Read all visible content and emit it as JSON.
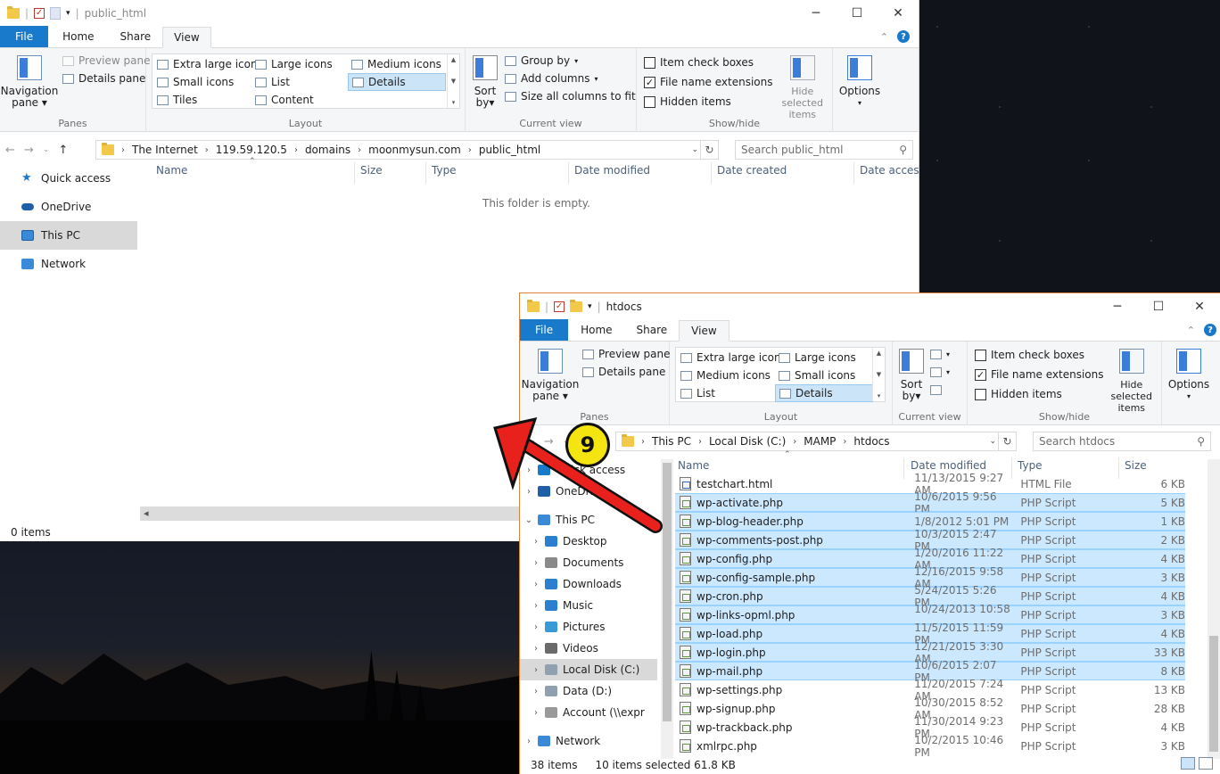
{
  "window1": {
    "title": "public_html",
    "tabs": {
      "file": "File",
      "home": "Home",
      "share": "Share",
      "view": "View"
    },
    "ribbon": {
      "panes": {
        "nav_pane": "Navigation",
        "nav_pane2": "pane",
        "preview": "Preview pane",
        "details": "Details pane",
        "label": "Panes"
      },
      "layout": {
        "items": [
          "Extra large icons",
          "Large icons",
          "Medium icons",
          "Small icons",
          "List",
          "Details",
          "Tiles",
          "Content"
        ],
        "selected": "Details",
        "label": "Layout"
      },
      "current_view": {
        "sort1": "Sort",
        "sort2": "by",
        "group": "Group by",
        "add_cols": "Add columns",
        "size_cols": "Size all columns to fit",
        "label": "Current view"
      },
      "show_hide": {
        "item_checkboxes": "Item check boxes",
        "file_ext": "File name extensions",
        "hidden": "Hidden items",
        "hide_sel1": "Hide selected",
        "hide_sel2": "items",
        "label": "Show/hide",
        "item_checkboxes_checked": false,
        "file_ext_checked": true,
        "hidden_checked": false
      },
      "options": "Options"
    },
    "address": {
      "crumbs": [
        "The Internet",
        "119.59.120.5",
        "domains",
        "moonmysun.com",
        "public_html"
      ]
    },
    "search": {
      "placeholder": "Search public_html"
    },
    "nav": [
      "Quick access",
      "OneDrive",
      "This PC",
      "Network"
    ],
    "nav_selected": "This PC",
    "columns": [
      "Name",
      "Size",
      "Type",
      "Date modified",
      "Date created",
      "Date accessed"
    ],
    "empty": "This folder is empty.",
    "status": "0 items"
  },
  "window2": {
    "title": "htdocs",
    "tabs": {
      "file": "File",
      "home": "Home",
      "share": "Share",
      "view": "View"
    },
    "ribbon": {
      "panes": {
        "nav_pane": "Navigation",
        "nav_pane2": "pane",
        "preview": "Preview pane",
        "details": "Details pane",
        "label": "Panes"
      },
      "layout": {
        "items": [
          "Extra large icons",
          "Large icons",
          "Medium icons",
          "Small icons",
          "List",
          "Details"
        ],
        "selected": "Details",
        "label": "Layout"
      },
      "current_view": {
        "sort1": "Sort",
        "sort2": "by",
        "label": "Current view"
      },
      "show_hide": {
        "item_checkboxes": "Item check boxes",
        "file_ext": "File name extensions",
        "hidden": "Hidden items",
        "hide_sel1": "Hide selected",
        "hide_sel2": "items",
        "label": "Show/hide"
      },
      "options": "Options"
    },
    "address": {
      "crumbs": [
        "This PC",
        "Local Disk (C:)",
        "MAMP",
        "htdocs"
      ]
    },
    "search": {
      "placeholder": "Search htdocs"
    },
    "nav": [
      {
        "label": "Quick access",
        "chev": "›"
      },
      {
        "label": "OneDrive",
        "chev": "›"
      },
      {
        "label": "This PC",
        "chev": "⌄"
      },
      {
        "label": "Desktop",
        "chev": "›"
      },
      {
        "label": "Documents",
        "chev": "›"
      },
      {
        "label": "Downloads",
        "chev": "›"
      },
      {
        "label": "Music",
        "chev": "›"
      },
      {
        "label": "Pictures",
        "chev": "›"
      },
      {
        "label": "Videos",
        "chev": "›"
      },
      {
        "label": "Local Disk (C:)",
        "chev": "›"
      },
      {
        "label": "Data (D:)",
        "chev": "›"
      },
      {
        "label": "Account (\\\\expr",
        "chev": "›"
      },
      {
        "label": "Network",
        "chev": "›"
      }
    ],
    "columns": [
      "Name",
      "Date modified",
      "Type",
      "Size"
    ],
    "files": [
      {
        "name": "testchart.html",
        "date": "11/13/2015 9:27 AM",
        "type": "HTML File",
        "size": "6 KB",
        "selected": false,
        "kind": "html"
      },
      {
        "name": "wp-activate.php",
        "date": "10/6/2015 9:56 PM",
        "type": "PHP Script",
        "size": "5 KB",
        "selected": true,
        "kind": "php"
      },
      {
        "name": "wp-blog-header.php",
        "date": "1/8/2012 5:01 PM",
        "type": "PHP Script",
        "size": "1 KB",
        "selected": true,
        "kind": "php"
      },
      {
        "name": "wp-comments-post.php",
        "date": "10/3/2015 2:47 PM",
        "type": "PHP Script",
        "size": "2 KB",
        "selected": true,
        "kind": "php"
      },
      {
        "name": "wp-config.php",
        "date": "1/20/2016 11:22 AM",
        "type": "PHP Script",
        "size": "4 KB",
        "selected": true,
        "kind": "php"
      },
      {
        "name": "wp-config-sample.php",
        "date": "12/16/2015 9:58 AM",
        "type": "PHP Script",
        "size": "3 KB",
        "selected": true,
        "kind": "php"
      },
      {
        "name": "wp-cron.php",
        "date": "5/24/2015 5:26 PM",
        "type": "PHP Script",
        "size": "4 KB",
        "selected": true,
        "kind": "php"
      },
      {
        "name": "wp-links-opml.php",
        "date": "10/24/2013 10:58 ...",
        "type": "PHP Script",
        "size": "3 KB",
        "selected": true,
        "kind": "php"
      },
      {
        "name": "wp-load.php",
        "date": "11/5/2015 11:59 PM",
        "type": "PHP Script",
        "size": "4 KB",
        "selected": true,
        "kind": "php"
      },
      {
        "name": "wp-login.php",
        "date": "12/21/2015 3:30 AM",
        "type": "PHP Script",
        "size": "33 KB",
        "selected": true,
        "kind": "php"
      },
      {
        "name": "wp-mail.php",
        "date": "10/6/2015 2:07 PM",
        "type": "PHP Script",
        "size": "8 KB",
        "selected": true,
        "kind": "php"
      },
      {
        "name": "wp-settings.php",
        "date": "11/20/2015 7:24 AM",
        "type": "PHP Script",
        "size": "13 KB",
        "selected": false,
        "kind": "php"
      },
      {
        "name": "wp-signup.php",
        "date": "10/30/2015 8:52 AM",
        "type": "PHP Script",
        "size": "28 KB",
        "selected": false,
        "kind": "php"
      },
      {
        "name": "wp-trackback.php",
        "date": "11/30/2014 9:23 PM",
        "type": "PHP Script",
        "size": "4 KB",
        "selected": false,
        "kind": "php"
      },
      {
        "name": "xmlrpc.php",
        "date": "10/2/2015 10:46 PM",
        "type": "PHP Script",
        "size": "3 KB",
        "selected": false,
        "kind": "php"
      }
    ],
    "status": {
      "items": "38 items",
      "selected": "10 items selected  61.8 KB"
    }
  },
  "annotation": {
    "step": "9",
    "arrow_color": "#e8211d",
    "badge_color": "#f4e40f"
  },
  "colors": {
    "accent": "#1979ca",
    "selection": "#cce8ff"
  }
}
